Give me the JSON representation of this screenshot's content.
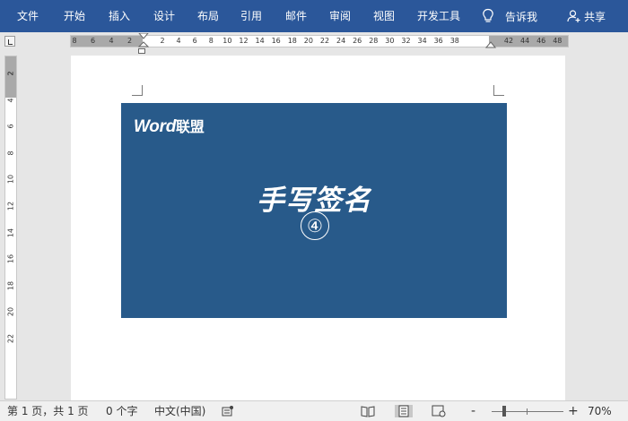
{
  "ribbon": {
    "tabs": [
      "文件",
      "开始",
      "插入",
      "设计",
      "布局",
      "引用",
      "邮件",
      "审阅",
      "视图",
      "开发工具"
    ],
    "tell_me": "告诉我",
    "share": "共享",
    "colors": {
      "ribbon_bg": "#2b579a",
      "text": "#ffffff"
    }
  },
  "ruler": {
    "left_ticks": [
      "8",
      "6",
      "4",
      "2"
    ],
    "main_ticks": [
      "2",
      "4",
      "6",
      "8",
      "10",
      "12",
      "14",
      "16",
      "18",
      "20",
      "22",
      "24",
      "26",
      "28",
      "30",
      "32",
      "34",
      "36",
      "38"
    ],
    "right_ticks": [
      "42",
      "44",
      "46",
      "48"
    ],
    "vertical_ticks": [
      "2",
      "2",
      "4",
      "6",
      "8",
      "10",
      "12",
      "14",
      "16",
      "18",
      "20",
      "22"
    ]
  },
  "document": {
    "banner": {
      "brand": "Word",
      "brand_cn": "联盟",
      "title": "手写签名",
      "number": "④",
      "bg_color": "#285a8a"
    }
  },
  "status": {
    "page": "第 1 页，共 1 页",
    "words": "0 个字",
    "language": "中文(中国)",
    "zoom_minus": "-",
    "zoom_plus": "+",
    "zoom": "70%",
    "zoom_fraction": 0.7
  }
}
